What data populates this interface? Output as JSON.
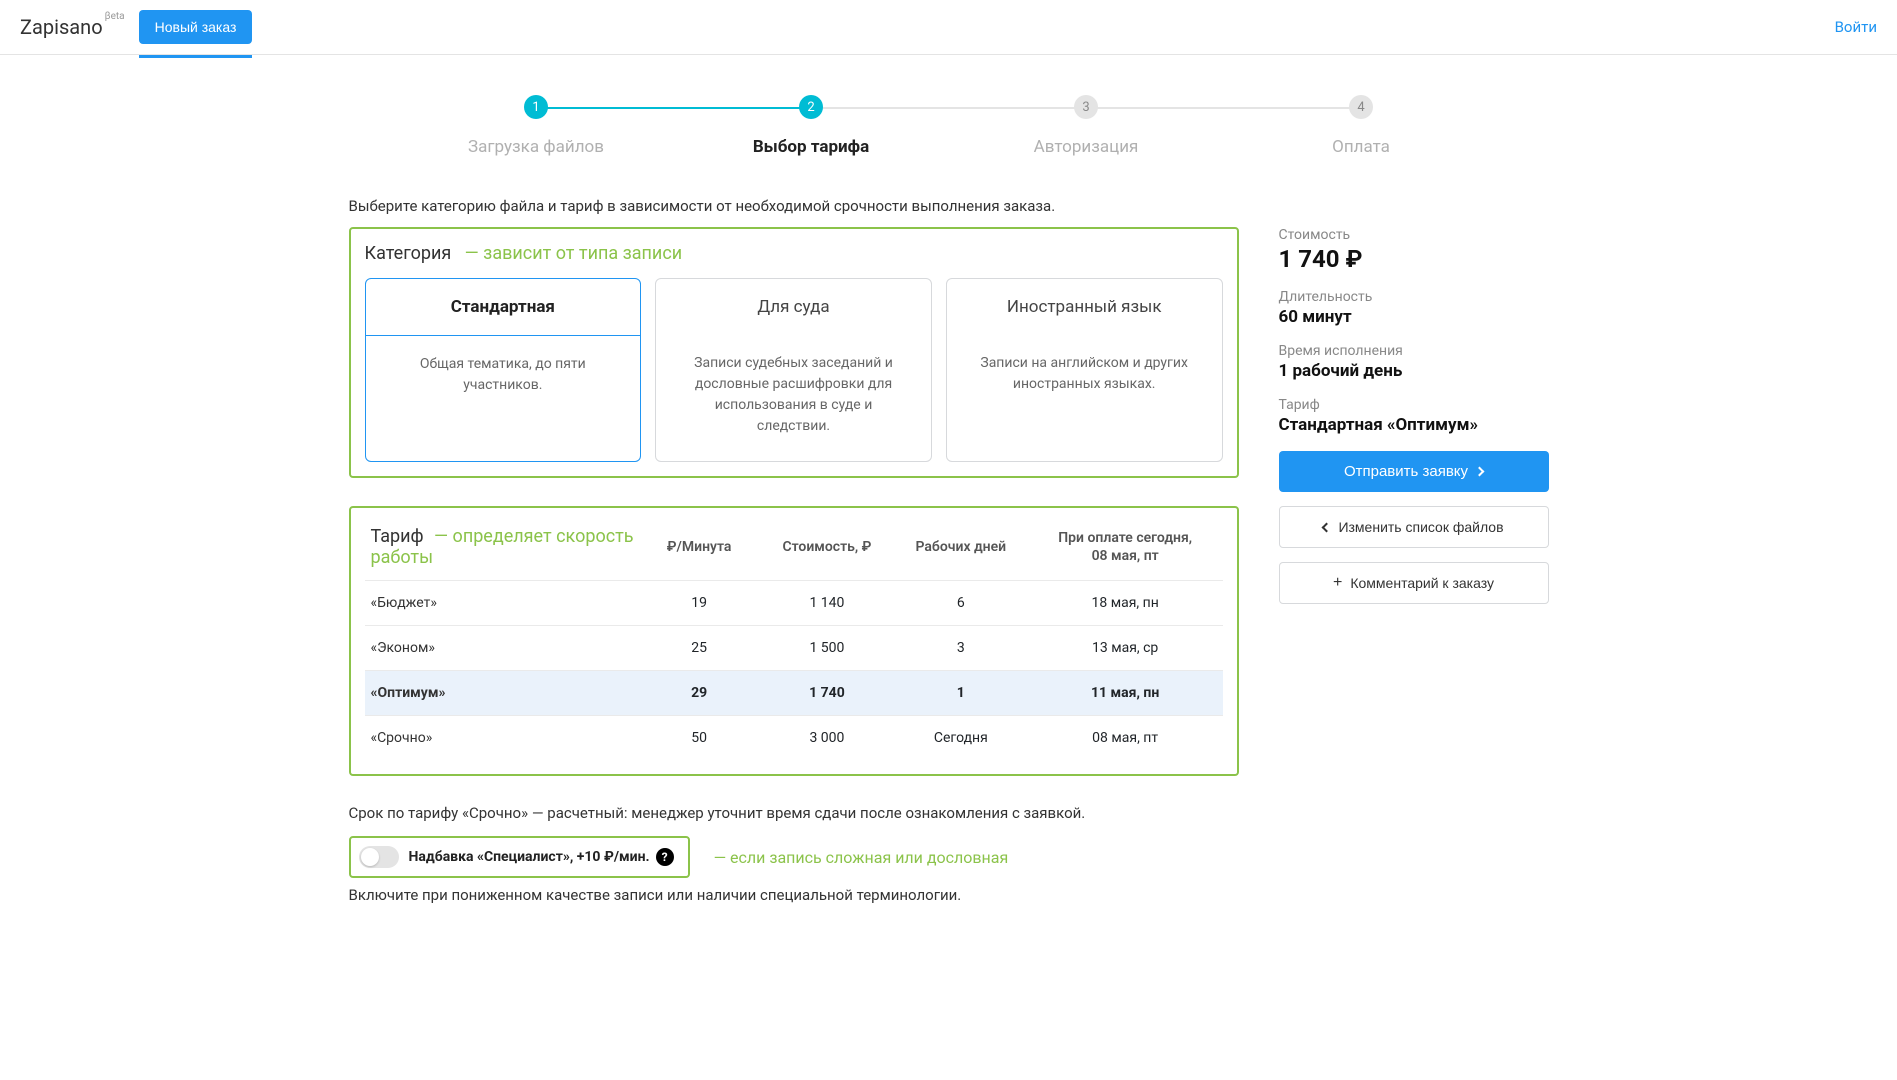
{
  "header": {
    "logo": "Zapisano",
    "beta": "βeta",
    "new_order": "Новый заказ",
    "login": "Войти"
  },
  "stepper": {
    "steps": [
      {
        "num": "1",
        "label": "Загрузка файлов"
      },
      {
        "num": "2",
        "label": "Выбор тарифа"
      },
      {
        "num": "3",
        "label": "Авторизация"
      },
      {
        "num": "4",
        "label": "Оплата"
      }
    ]
  },
  "intro": "Выберите категорию файла и тариф в зависимости от необходимой срочности выполнения заказа.",
  "category": {
    "title": "Категория",
    "hint": "— зависит от типа записи",
    "cards": [
      {
        "title": "Стандартная",
        "desc": "Общая тематика, до пяти участников."
      },
      {
        "title": "Для суда",
        "desc": "Записи судебных заседаний и дословные расшифровки для использования в суде и следствии."
      },
      {
        "title": "Иностранный язык",
        "desc": "Записи на английском и других иностранных языках."
      }
    ]
  },
  "tariff": {
    "title": "Тариф",
    "hint": "— определяет скорость работы",
    "headers": {
      "per_min": "₽/Минута",
      "cost": "Стоимость, ₽",
      "days": "Рабочих дней",
      "pay_today_line1": "При оплате сегодня,",
      "pay_today_line2": "08 мая, пт"
    },
    "rows": [
      {
        "name": "«Бюджет»",
        "per_min": "19",
        "cost": "1 140",
        "days": "6",
        "date": "18 мая, пн"
      },
      {
        "name": "«Эконом»",
        "per_min": "25",
        "cost": "1 500",
        "days": "3",
        "date": "13 мая, ср"
      },
      {
        "name": "«Оптимум»",
        "per_min": "29",
        "cost": "1 740",
        "days": "1",
        "date": "11 мая, пн"
      },
      {
        "name": "«Срочно»",
        "per_min": "50",
        "cost": "3 000",
        "days": "Сегодня",
        "date": "08 мая, пт"
      }
    ]
  },
  "urgent_note": "Срок по тарифу «Срочно»  — расчетный: менеджер уточнит время сдачи после ознакомления с заявкой.",
  "addon": {
    "label": "Надбавка «Специалист», +10 ₽/мин.",
    "hint": "— если запись сложная или дословная",
    "note": "Включите при пониженном качестве записи или наличии специальной терминологии."
  },
  "sidebar": {
    "cost_label": "Стоимость",
    "cost_value": "1 740 ₽",
    "duration_label": "Длительность",
    "duration_value": "60 минут",
    "time_label": "Время исполнения",
    "time_value": "1 рабочий день",
    "tariff_label": "Тариф",
    "tariff_value": "Стандартная «Оптимум»",
    "submit": "Отправить заявку",
    "change_files": "Изменить список файлов",
    "comment": "Комментарий к заказу"
  }
}
